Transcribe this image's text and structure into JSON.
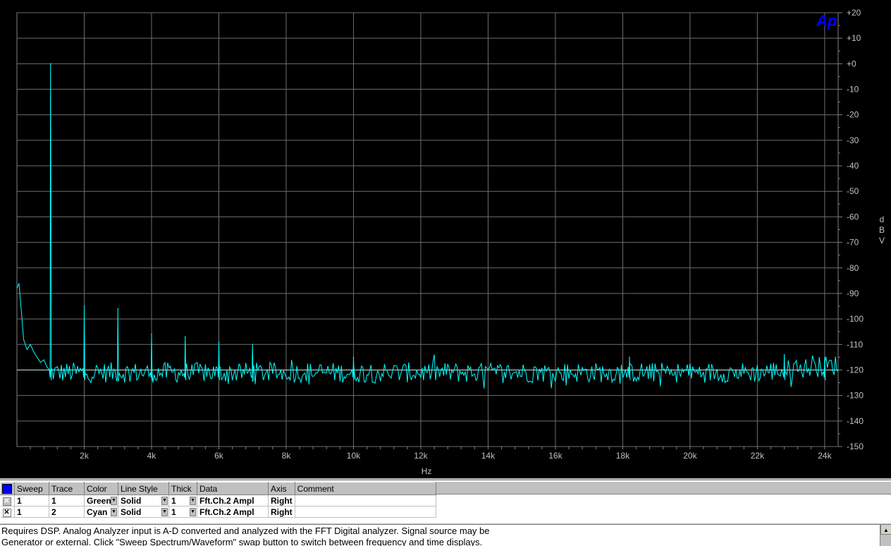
{
  "chart_data": {
    "type": "line",
    "title": "",
    "xlabel": "Hz",
    "ylabel": "dBV",
    "xlim": [
      0,
      24400
    ],
    "ylim": [
      -150,
      20
    ],
    "x_ticks": [
      2000,
      4000,
      6000,
      8000,
      10000,
      12000,
      14000,
      16000,
      18000,
      20000,
      22000,
      24000
    ],
    "x_tick_labels": [
      "2k",
      "4k",
      "6k",
      "8k",
      "10k",
      "12k",
      "14k",
      "16k",
      "18k",
      "20k",
      "22k",
      "24k"
    ],
    "y_ticks": [
      20,
      10,
      0,
      -10,
      -20,
      -30,
      -40,
      -50,
      -60,
      -70,
      -80,
      -90,
      -100,
      -110,
      -120,
      -130,
      -140,
      -150
    ],
    "y_tick_labels": [
      "+20",
      "+10",
      "+0",
      "-10",
      "-20",
      "-30",
      "-40",
      "-50",
      "-60",
      "-70",
      "-80",
      "-90",
      "-100",
      "-110",
      "-120",
      "-130",
      "-140",
      "-150"
    ],
    "y_axis_side": "right",
    "grid": true,
    "series": [
      {
        "color": "#00ffff",
        "noise_floor": -121,
        "noise_amplitude": 4,
        "low_freq_points": [
          [
            0,
            -88
          ],
          [
            60,
            -86
          ],
          [
            120,
            -95
          ],
          [
            200,
            -108
          ],
          [
            300,
            -112
          ],
          [
            400,
            -110
          ],
          [
            500,
            -113
          ],
          [
            600,
            -115
          ],
          [
            700,
            -117
          ],
          [
            800,
            -116
          ],
          [
            900,
            -119
          ]
        ],
        "peaks": [
          [
            1000,
            0
          ],
          [
            2000,
            -95
          ],
          [
            3000,
            -96
          ],
          [
            4000,
            -106
          ],
          [
            5000,
            -107
          ],
          [
            6000,
            -109
          ],
          [
            7000,
            -110
          ],
          [
            10000,
            -115
          ],
          [
            18200,
            -115
          ],
          [
            22800,
            -114
          ],
          [
            24000,
            -115
          ]
        ]
      }
    ],
    "reference_line": -120
  },
  "brand": {
    "logo_text": "Ap",
    "logo_color": "#0000ff"
  },
  "legend": {
    "headers": [
      "Sweep",
      "Trace",
      "Color",
      "Line Style",
      "Thick",
      "Data",
      "Axis",
      "Comment"
    ],
    "rows": [
      {
        "checked": false,
        "sweep": "1",
        "trace": "1",
        "color": "Green",
        "line_style": "Solid",
        "thick": "1",
        "data": "Fft.Ch.2 Ampl",
        "axis": "Right",
        "comment": ""
      },
      {
        "checked": true,
        "sweep": "1",
        "trace": "2",
        "color": "Cyan",
        "line_style": "Solid",
        "thick": "1",
        "data": "Fft.Ch.2 Ampl",
        "axis": "Right",
        "comment": ""
      }
    ]
  },
  "status": {
    "line1": "Requires DSP.  Analog Analyzer input is A-D converted and analyzed with the FFT Digital analyzer.  Signal source may be",
    "line2": "Generator or external.  Click \"Sweep Spectrum/Waveform\" swap button to switch between frequency and time displays."
  }
}
